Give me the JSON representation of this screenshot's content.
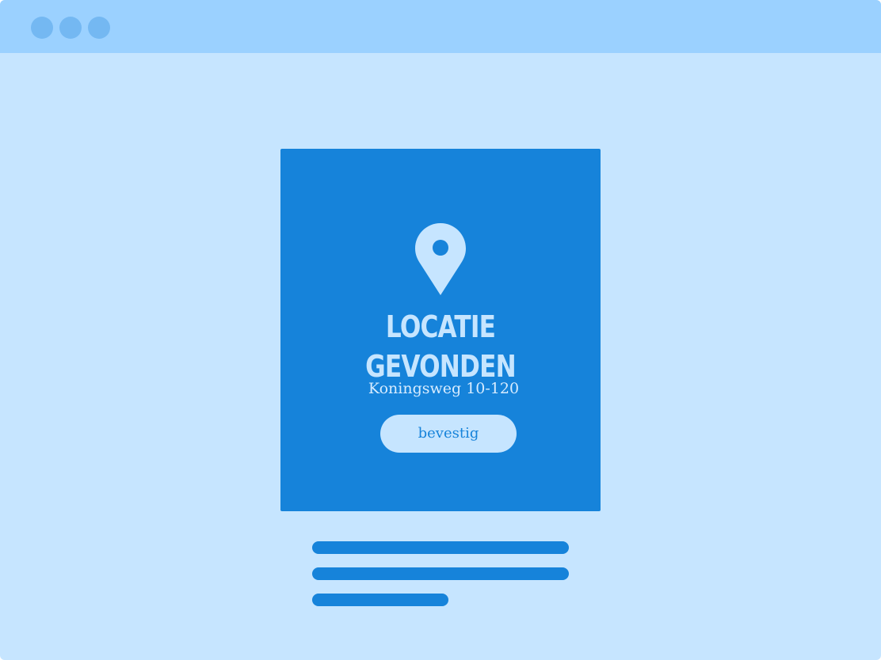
{
  "window": {
    "controls": [
      "dot",
      "dot",
      "dot"
    ]
  },
  "card": {
    "icon": "map-pin-icon",
    "title": "LOCATiE GEVONDEN",
    "address": "Koningsweg 10-120",
    "confirm_label": "bevestig"
  },
  "colors": {
    "background": "#c6e5ff",
    "titlebar": "#9bd1ff",
    "window_dot": "#74b8f2",
    "card": "#1683da",
    "card_text": "#c6e5ff"
  }
}
